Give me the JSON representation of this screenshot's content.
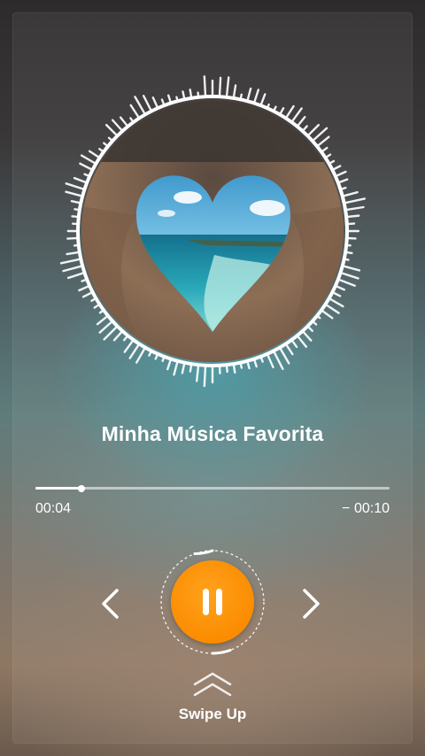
{
  "player": {
    "song_title": "Minha Música Favorita",
    "progress": 0.13,
    "time_elapsed": "00:04",
    "time_remaining": "− 00:10",
    "state": "playing"
  },
  "controls": {
    "prev_icon": "chevron-left-icon",
    "pause_icon": "pause-icon",
    "next_icon": "chevron-right-icon"
  },
  "swipe": {
    "label": "Swipe Up",
    "icon": "double-chevron-up-icon"
  },
  "colors": {
    "accent": "#fb8c00",
    "text": "#ffffff"
  }
}
